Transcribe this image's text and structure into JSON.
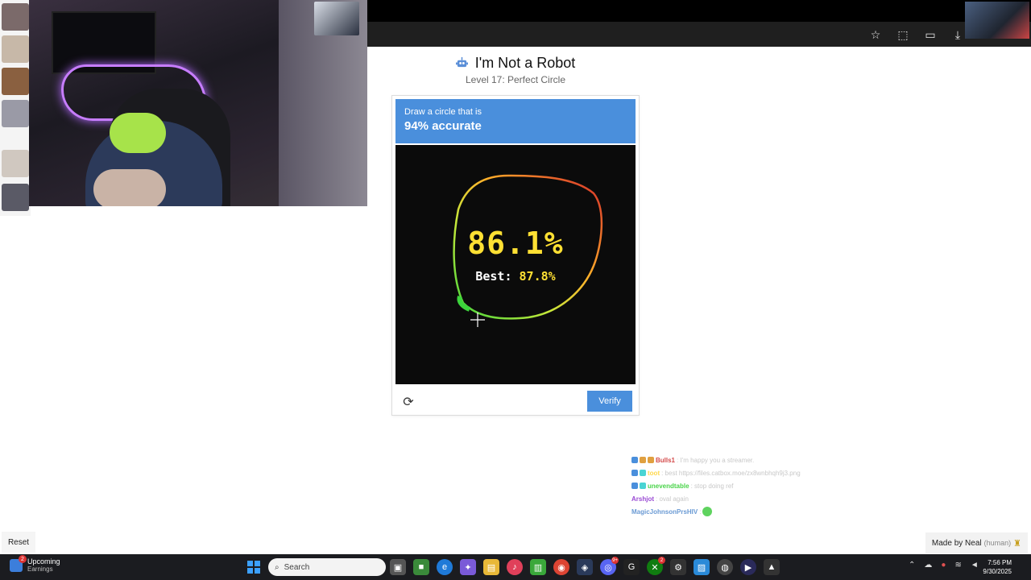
{
  "page": {
    "title": "I'm Not a Robot",
    "robot_icon": "robot-icon",
    "level": "Level 17: Perfect Circle"
  },
  "captcha": {
    "instruction": "Draw a circle that is",
    "target": "94% accurate",
    "score": "86.1%",
    "best_label": "Best:",
    "best_value": "87.8%",
    "verify_label": "Verify",
    "refresh_icon": "refresh-icon",
    "header_color": "#4a8fdc",
    "score_color": "#ffe033"
  },
  "chat": {
    "messages": [
      {
        "name": "Bulls1",
        "name_color": "#d44a4a",
        "text": ": I'm happy you a streamer."
      },
      {
        "name": "toot",
        "name_color": "#ffd84a",
        "text": ": best https://files.catbox.moe/zx8wnbhqh9j3.png"
      },
      {
        "name": "unevendtable",
        "name_color": "#4ad44a",
        "text": ": stop doing ref"
      },
      {
        "name": "Arshjot",
        "name_color": "#9a4ad4",
        "text": ": oval again"
      },
      {
        "name": "MagicJohnsonPrsHIV",
        "name_color": "#6a9ad4",
        "text": ":"
      }
    ]
  },
  "footer": {
    "reset_label": "Reset",
    "made_by": "Made by Neal",
    "made_by_note": "(human)"
  },
  "taskbar": {
    "widget_title": "Upcoming",
    "widget_sub": "Earnings",
    "widget_badge": "2",
    "search_label": "Search",
    "discord_badge": "9+",
    "xbox_badge": "2",
    "time": "7:56 PM",
    "date": "9/30/2025"
  }
}
